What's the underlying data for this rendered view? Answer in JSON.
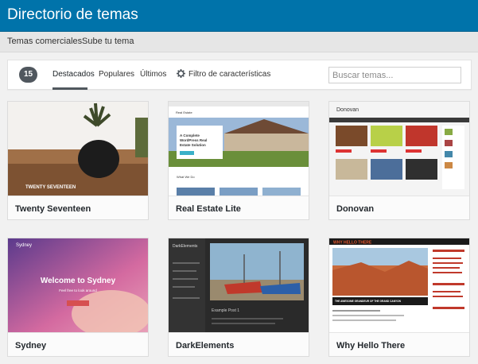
{
  "header": {
    "title": "Directorio de temas"
  },
  "subnav": {
    "items": [
      {
        "label": "Temas comerciales"
      },
      {
        "label": "Sube tu tema"
      }
    ]
  },
  "filter": {
    "count": "15",
    "tabs": [
      {
        "label": "Destacados"
      },
      {
        "label": "Populares"
      },
      {
        "label": "Últimos"
      }
    ],
    "feature_filter": "Filtro de características",
    "search_placeholder": "Buscar temas..."
  },
  "themes": [
    {
      "name": "Twenty Seventeen",
      "preview_text": "TWENTY SEVENTEEN"
    },
    {
      "name": "Real Estate Lite",
      "preview_text": "A Complete WordPress Real Estate Solution",
      "preview_brand": "Real Estate",
      "preview_section": "What We Do"
    },
    {
      "name": "Donovan",
      "preview_text": "Donovan"
    },
    {
      "name": "Sydney",
      "preview_text": "Welcome to Sydney",
      "preview_sub": "Feel free to look around",
      "preview_brand": "Sydney"
    },
    {
      "name": "DarkElements",
      "preview_text": "DarkElements",
      "preview_post": "Example Post 1"
    },
    {
      "name": "Why Hello There",
      "preview_text": "WHY HELLO THERE",
      "preview_post": "THE AWESOME GRANDEUR OF THE GRAND CANYON"
    }
  ]
}
